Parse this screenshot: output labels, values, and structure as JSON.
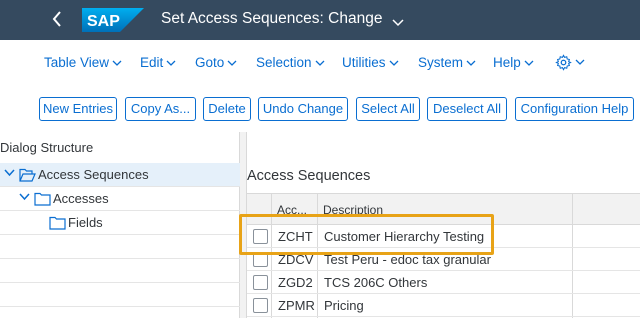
{
  "shell": {
    "title": "Set Access Sequences: Change",
    "logo_text": "SAP"
  },
  "menu": {
    "items": [
      "Table View",
      "Edit",
      "Goto",
      "Selection",
      "Utilities",
      "System",
      "Help"
    ]
  },
  "toolbar": {
    "buttons": [
      "New Entries",
      "Copy As...",
      "Delete",
      "Undo Change",
      "Select All",
      "Deselect All",
      "Configuration Help"
    ]
  },
  "dialog_structure": {
    "title": "Dialog Structure",
    "nodes": [
      {
        "label": "Access Sequences",
        "level": 0,
        "expanded": true,
        "selected": true
      },
      {
        "label": "Accesses",
        "level": 1,
        "expanded": true,
        "selected": false
      },
      {
        "label": "Fields",
        "level": 2,
        "expanded": false,
        "selected": false
      }
    ]
  },
  "table": {
    "title": "Access Sequences",
    "columns": [
      "Acc...",
      "Description"
    ],
    "rows": [
      {
        "access": "ZCHT",
        "description": "Customer Hierarchy Testing",
        "highlighted": true
      },
      {
        "access": "ZDCV",
        "description": "Test Peru - edoc tax granular",
        "highlighted": false
      },
      {
        "access": "ZGD2",
        "description": "TCS 206C Others",
        "highlighted": false
      },
      {
        "access": "ZPMR",
        "description": "Pricing",
        "highlighted": false
      }
    ]
  },
  "colors": {
    "shell_bg": "#354a5f",
    "accent": "#0a6ed1",
    "highlight": "#e8a317",
    "selected_row": "#e5f0fa"
  }
}
